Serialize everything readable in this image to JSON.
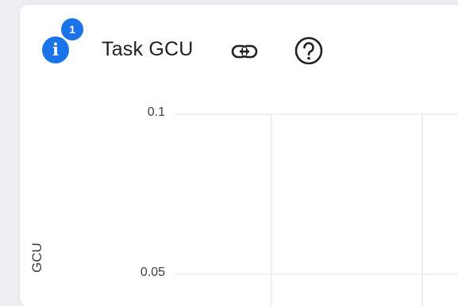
{
  "card": {
    "badge_count": "1",
    "info_glyph": "i",
    "title": "Task GCU",
    "link_icon": "link-icon",
    "help_icon": "help-icon"
  },
  "chart_data": {
    "type": "line",
    "ylabel": "GCU",
    "y_ticks": [
      "0.1",
      "0.05"
    ],
    "y_tick_values": [
      0.1,
      0.05
    ],
    "grid": true
  },
  "colors": {
    "accent": "#1a73e8",
    "grid": "#e6e6e6",
    "background": "#eceef1"
  }
}
